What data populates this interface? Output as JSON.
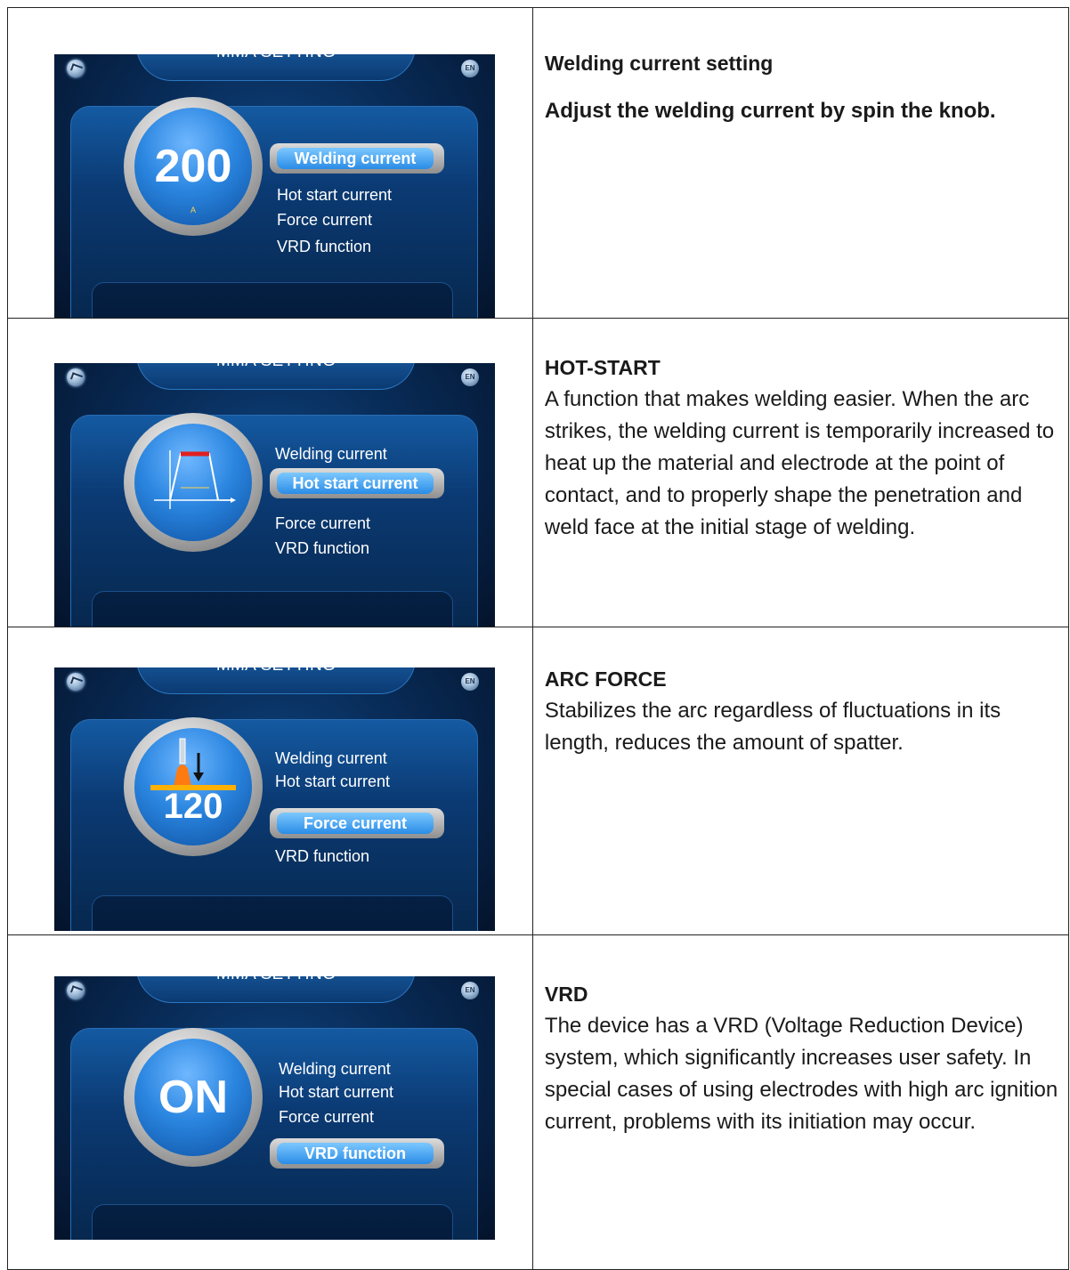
{
  "rows": [
    {
      "screen": {
        "title": "MMA SETTING",
        "lang": "EN",
        "dial_value": "200",
        "dial_unit": "A",
        "menu": [
          "Welding current",
          "Hot start current",
          "Force current",
          "VRD function"
        ],
        "selected_index": 0
      },
      "heading": "Welding current setting",
      "text": "Adjust the welding current by spin the knob."
    },
    {
      "screen": {
        "title": "MMA SETTING",
        "lang": "EN",
        "dial_icon": "hot-start-graph-icon",
        "menu": [
          "Welding current",
          "Hot start current",
          "Force current",
          "VRD function"
        ],
        "selected_index": 1
      },
      "heading": "HOT-START",
      "text": "A  function that makes welding easier. When the arc strikes, the welding current is temporarily increased to heat up the material and electrode at the point of contact, and to properly shape the penetration and weld face at the initial stage of welding."
    },
    {
      "screen": {
        "title": "MMA SETTING",
        "lang": "EN",
        "dial_value": "120",
        "dial_icon": "arc-force-icon",
        "menu": [
          "Welding current",
          "Hot start current",
          "Force current",
          "VRD function"
        ],
        "selected_index": 2
      },
      "heading": "ARC FORCE",
      "text": "Stabilizes the arc regardless of fluctuations in its length, reduces the amount of spatter."
    },
    {
      "screen": {
        "title": "MMA SETTING",
        "lang": "EN",
        "dial_value": "ON",
        "menu": [
          "Welding current",
          "Hot start current",
          "Force current",
          "VRD function"
        ],
        "selected_index": 3
      },
      "heading": "VRD",
      "text": "The device has a VRD (Voltage Reduction Device) system, which significantly increases user safety. In special cases of using electrodes with high arc ignition current, problems with its initiation may occur."
    }
  ],
  "colors": {
    "screen_bg": "#082a55",
    "dial_blue": "#2b86e0",
    "selected_blue": "#2a8ce6",
    "unit_yellow": "#ffd34d",
    "red_line": "#e02020"
  }
}
